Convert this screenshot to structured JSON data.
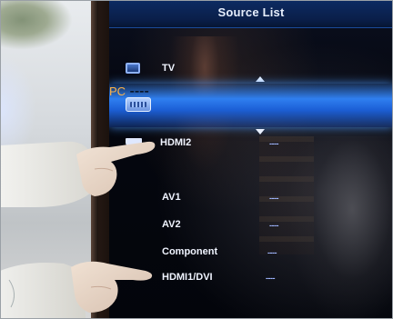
{
  "screen": {
    "title": "Source List"
  },
  "sources": [
    {
      "label": "TV",
      "value": "",
      "icon": "tv-icon",
      "selected": false
    },
    {
      "label": "PC",
      "value": "----",
      "icon": "pc-icon",
      "selected": true
    },
    {
      "label": "HDMI2",
      "value": "----",
      "icon": "hdmi-icon",
      "selected": false
    },
    {
      "label": "AV1",
      "value": "----",
      "icon": "",
      "selected": false
    },
    {
      "label": "AV2",
      "value": "----",
      "icon": "",
      "selected": false
    },
    {
      "label": "Component",
      "value": "----",
      "icon": "",
      "selected": false
    },
    {
      "label": "HDMI1/DVI",
      "value": "----",
      "icon": "",
      "selected": false
    }
  ],
  "colors": {
    "header": "#0d2b63",
    "selection": "#2f7ff0",
    "selected_text": "#ffb347",
    "text": "#f0f4ff"
  }
}
